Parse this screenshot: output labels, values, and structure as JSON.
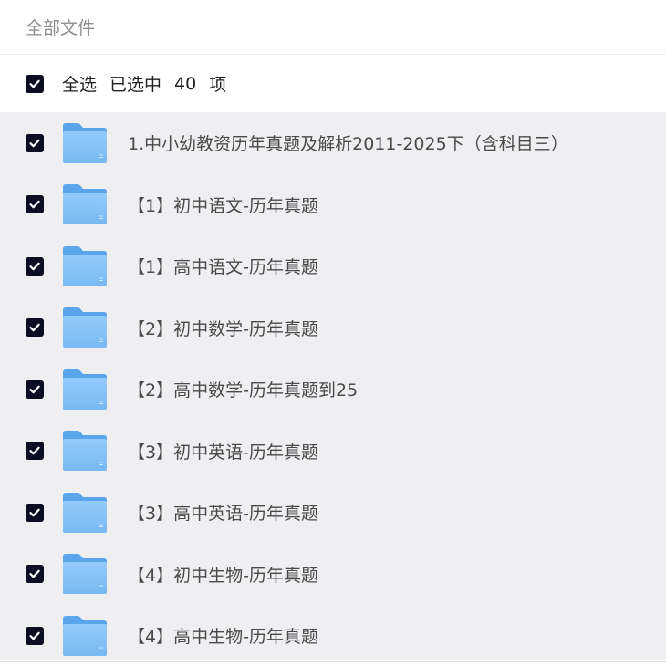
{
  "breadcrumb": {
    "title": "全部文件"
  },
  "selection": {
    "select_all_label": "全选",
    "selected_prefix": "已选中",
    "selected_count": "40",
    "selected_suffix": "项"
  },
  "files": [
    {
      "name": "1.中小幼教资历年真题及解析2011-2025下（含科目三）",
      "type": "folder",
      "checked": true
    },
    {
      "name": "【1】初中语文-历年真题",
      "type": "folder",
      "checked": true
    },
    {
      "name": "【1】高中语文-历年真题",
      "type": "folder",
      "checked": true
    },
    {
      "name": "【2】初中数学-历年真题",
      "type": "folder",
      "checked": true
    },
    {
      "name": "【2】高中数学-历年真题到25",
      "type": "folder",
      "checked": true
    },
    {
      "name": "【3】初中英语-历年真题",
      "type": "folder",
      "checked": true
    },
    {
      "name": "【3】高中英语-历年真题",
      "type": "folder",
      "checked": true
    },
    {
      "name": "【4】初中生物-历年真题",
      "type": "folder",
      "checked": true
    },
    {
      "name": "【4】高中生物-历年真题",
      "type": "folder",
      "checked": true
    }
  ],
  "icons": {
    "checkbox": "checkmark-icon",
    "folder": "folder-icon"
  },
  "colors": {
    "checkbox_fill": "#0c0c22",
    "list_background": "#efeff2",
    "folder_blue": "#6fb3f2"
  }
}
